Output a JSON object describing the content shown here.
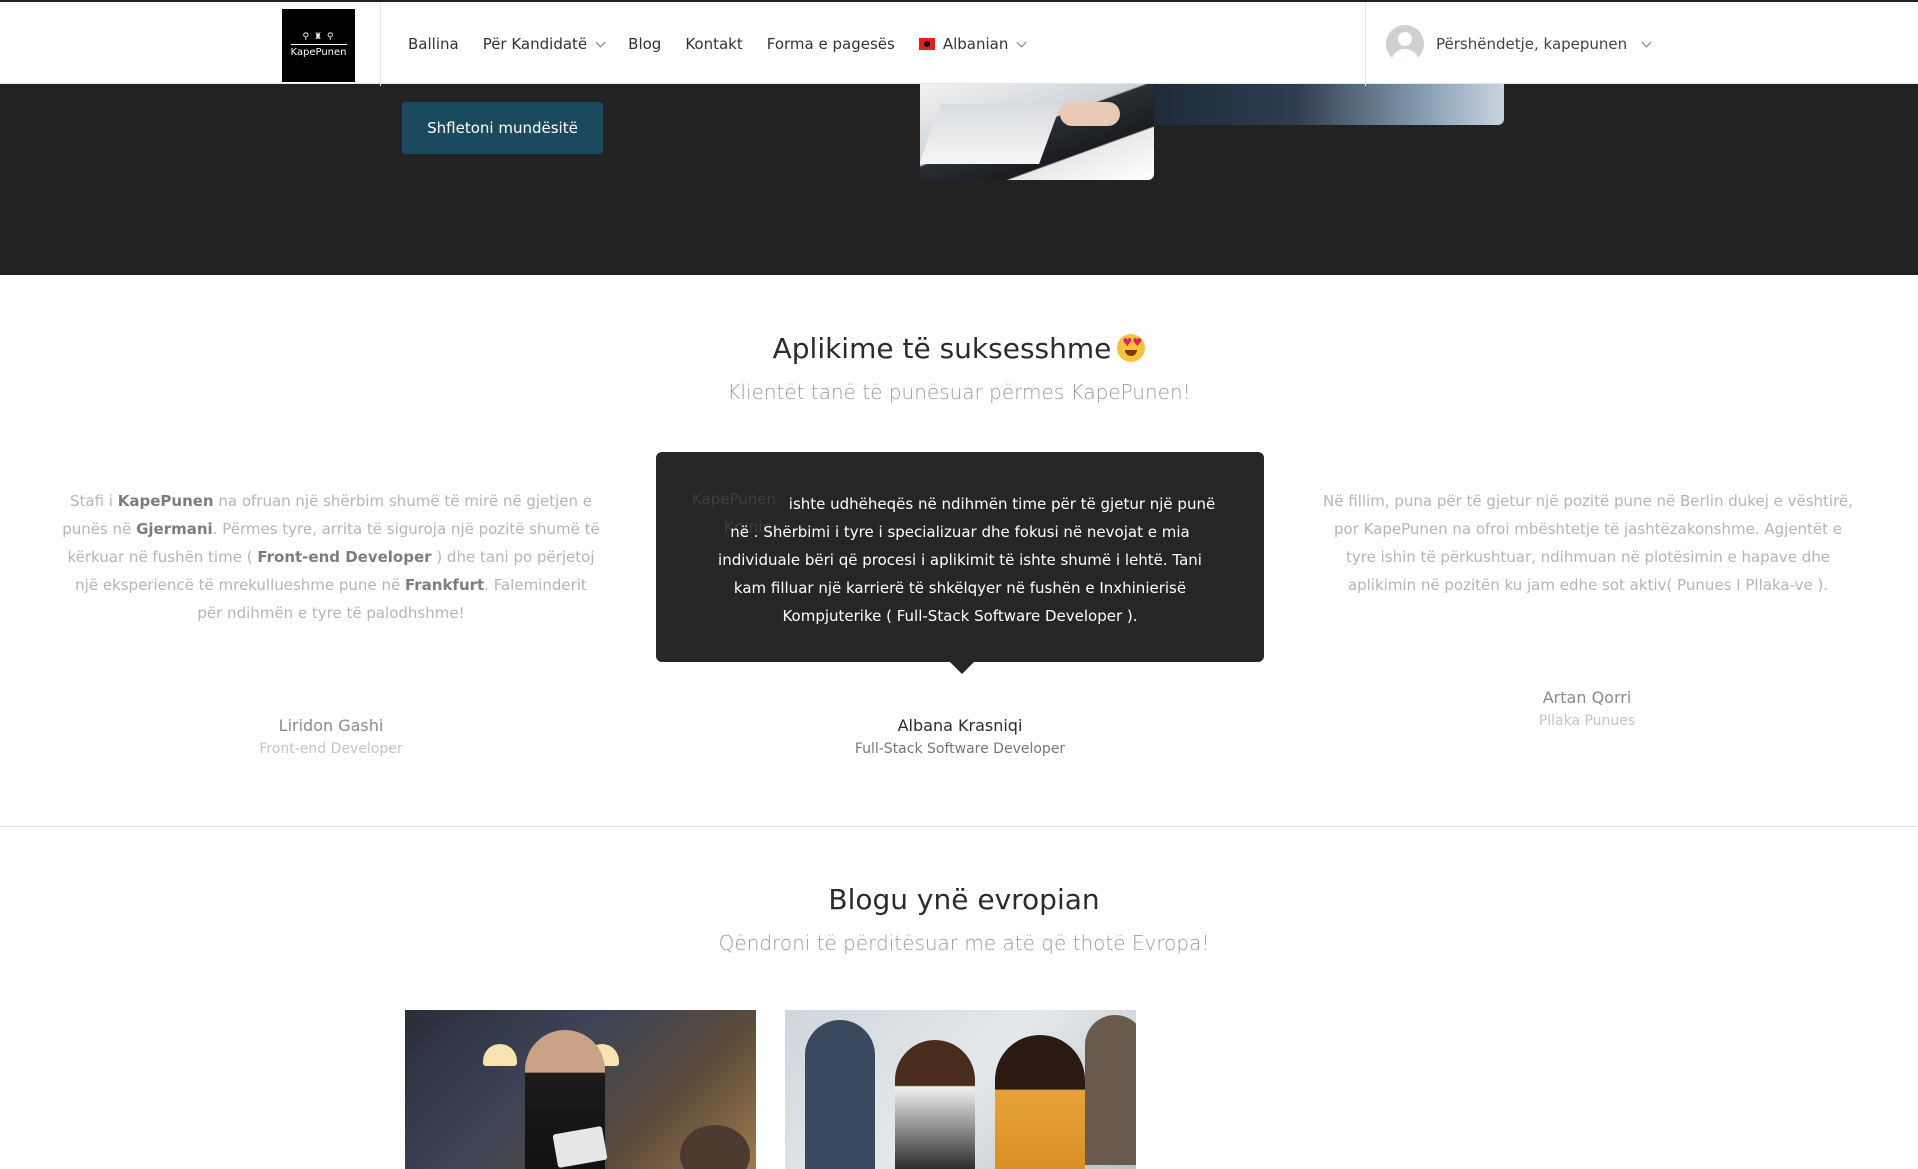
{
  "header": {
    "logo_mark": "⚲ ♜ ⚲",
    "logo_text": "KapePunen",
    "nav": [
      {
        "label": "Ballina"
      },
      {
        "label": "Për Kandidatë"
      },
      {
        "label": "Blog"
      },
      {
        "label": "Kontakt"
      },
      {
        "label": "Forma e pagesës"
      },
      {
        "label": "Albanian"
      }
    ],
    "user_greeting": "Përshëndetje, kapepunen"
  },
  "hero": {
    "button_label": "Shfletoni mundësitë"
  },
  "testimonials": {
    "title": "Aplikime të suksesshme",
    "subtitle": "Klientët tanë të punësuar përmes KapePunen!",
    "left": {
      "text_before": "Stafi i ",
      "brand": "KapePunen",
      "text_2": " na ofruan një shërbim shumë të mirë në gjetjen e punës në ",
      "country": "Gjermani",
      "text_3": ". Përmes tyre, arrita të siguroja një pozitë shumë të kërkuar në fushën time ( ",
      "role_bold": "Front-end Developer",
      "text_4": " ) dhe tani po përjetoj një eksperiencë të mrekullueshme pune në ",
      "city": "Frankfurt",
      "text_5": ". Faleminderit për ndihmën e tyre të palodhshme!",
      "name": "Liridon Gashi",
      "role": "Front-end Developer"
    },
    "center": {
      "ghost_brand": "KapePunen",
      "ghost_word": "Krynin",
      "text": "ishte udhëheqës në ndihmën time për të gjetur një punë në . Shërbimi i tyre i specializuar dhe fokusi në nevojat e mia individuale bëri që procesi i aplikimit të ishte shumë i lehtë. Tani kam filluar një karrierë të shkëlqyer në fushën e Inxhinierisë Kompjuterike ( Full-Stack Software Developer ).",
      "name": "Albana Krasniqi",
      "role": "Full-Stack Software Developer"
    },
    "right": {
      "text": "Në fillim, puna për të gjetur një pozitë pune në Berlin dukej e vështirë, por KapePunen na ofroi mbështetje të jashtëzakonshme. Agjentët e tyre ishin të përkushtuar, ndihmuan në plotësimin e hapave dhe aplikimin në pozitën ku jam edhe sot aktiv( Punues I Pllaka-ve ).",
      "name": "Artan Qorri",
      "role": "Pllaka Punues"
    }
  },
  "blog": {
    "title": "Blogu ynë evropian",
    "subtitle": "Qëndroni të përditësuar me atë që thotë Evropa!"
  },
  "colors": {
    "dark_band": "#222222",
    "button": "#1b4a5e",
    "tooltip_bg": "#262626"
  }
}
